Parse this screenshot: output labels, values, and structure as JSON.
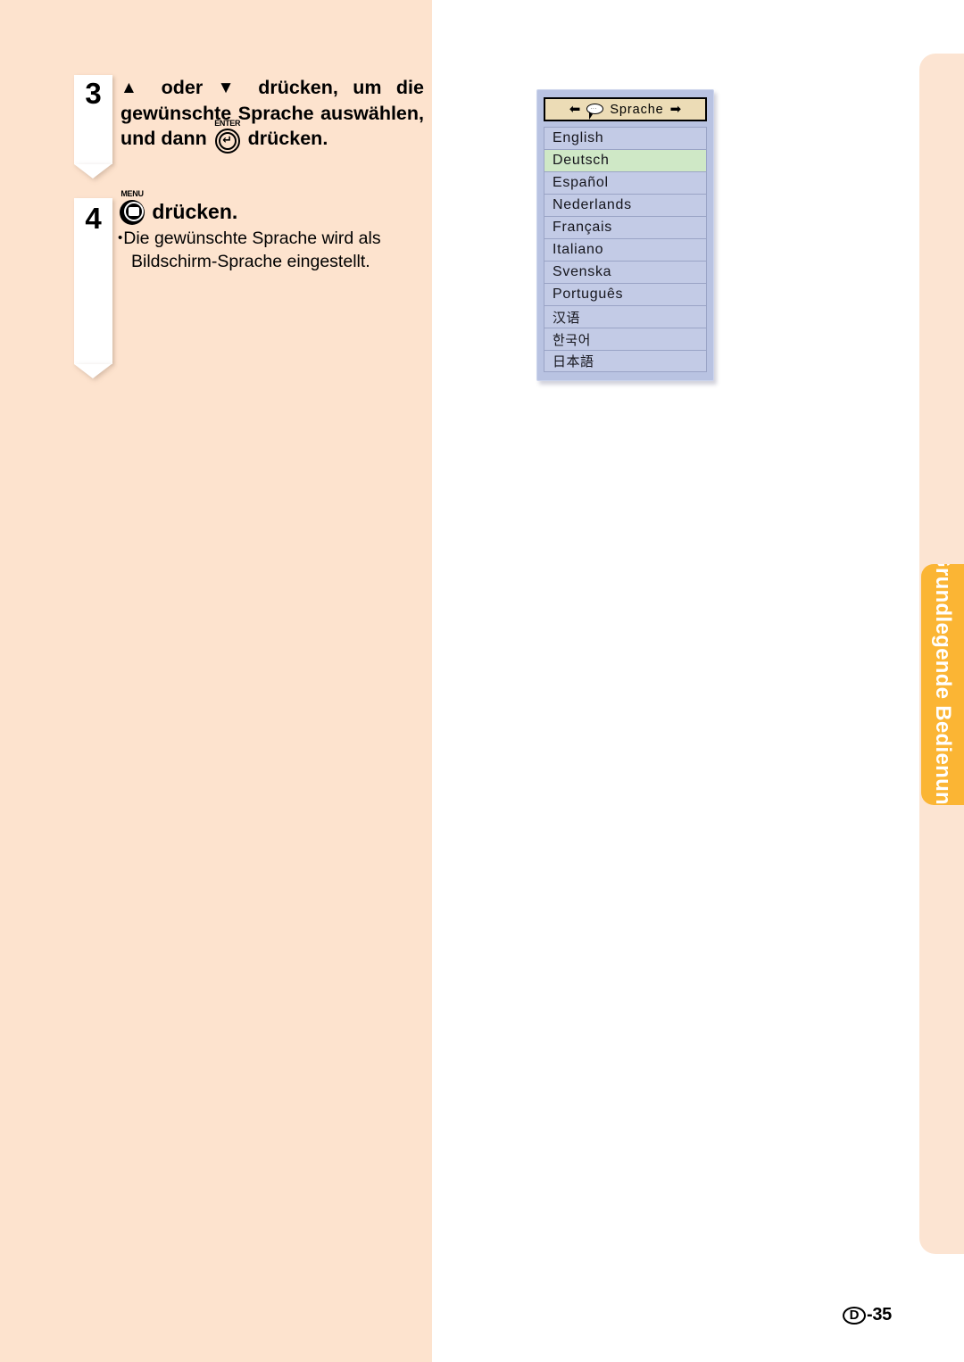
{
  "page": {
    "language_code": "D",
    "page_number": "-35",
    "background_color": "#ffffff",
    "left_column_color": "#fde3ce"
  },
  "section_tab": {
    "label": "Grundlegende Bedienung",
    "color": "#fbb534",
    "text_color": "#ffffff"
  },
  "steps": [
    {
      "number": "3",
      "heading_parts": {
        "up_arrow": "▲",
        "text_1": " oder ",
        "down_arrow": "▼",
        "text_2": " drücken, um die gewünschte Sprache auswählen, und dann ",
        "key_label": "ENTER",
        "key_glyph": "↵",
        "text_3": " drücken."
      }
    },
    {
      "number": "4",
      "key_label": "MENU",
      "heading": "drücken.",
      "note_line_1": "Die gewünschte Sprache wird als",
      "note_line_2": "Bildschirm-Sprache eingestellt.",
      "bullet": "•"
    }
  ],
  "osd_menu": {
    "header": {
      "left_arrow": "⬅",
      "right_arrow": "➡",
      "title": "Sprache",
      "icon": "speech-bubble-icon",
      "background_color": "#ecdcb6"
    },
    "panel_color": "#b9c3e2",
    "item_color": "#c3cbe6",
    "selected_color": "#cfe8c6",
    "selected_index": 1,
    "items": [
      {
        "label": "English",
        "cjk": false
      },
      {
        "label": "Deutsch",
        "cjk": false
      },
      {
        "label": "Español",
        "cjk": false
      },
      {
        "label": "Nederlands",
        "cjk": false
      },
      {
        "label": "Français",
        "cjk": false
      },
      {
        "label": "Italiano",
        "cjk": false
      },
      {
        "label": "Svenska",
        "cjk": false
      },
      {
        "label": "Português",
        "cjk": false
      },
      {
        "label": "汉语",
        "cjk": true
      },
      {
        "label": "한국어",
        "cjk": true
      },
      {
        "label": "日本語",
        "cjk": true
      }
    ]
  }
}
